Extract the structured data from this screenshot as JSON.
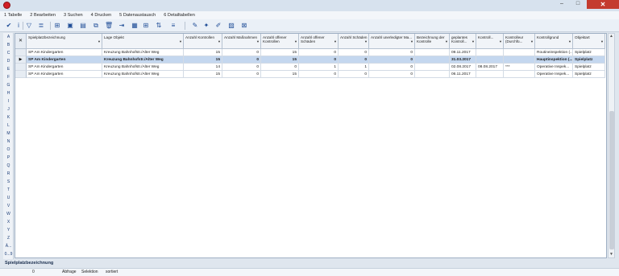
{
  "window": {
    "minimize": "–",
    "maximize": "□",
    "close": "✕"
  },
  "menu": [
    "1 Tabelle",
    "2 Bearbeiten",
    "3 Suchen",
    "4 Drucken",
    "5 Datenaustausch",
    "6 Detailtabellen"
  ],
  "toolbar_icons": [
    {
      "name": "checkmark-icon",
      "glyph": "✔"
    },
    {
      "name": "info-icon",
      "glyph": "i"
    },
    {
      "name": "filter-icon",
      "glyph": "▽"
    },
    {
      "name": "list-options-icon",
      "glyph": "≣"
    },
    {
      "name": "binoculars-icon",
      "glyph": "⊞"
    },
    {
      "name": "search-binoculars-icon",
      "glyph": "▣"
    },
    {
      "name": "document-icon",
      "glyph": "▤"
    },
    {
      "name": "copy-icon",
      "glyph": "⧉"
    },
    {
      "name": "trash-icon",
      "glyph": "🗑"
    },
    {
      "name": "export-icon",
      "glyph": "⇥"
    },
    {
      "name": "table-icon",
      "glyph": "▦"
    },
    {
      "name": "grid-icon",
      "glyph": "⊞"
    },
    {
      "name": "sort-icon",
      "glyph": "⇅"
    },
    {
      "name": "layout-icon",
      "glyph": "≡"
    },
    {
      "name": "edit-icon",
      "glyph": "✎"
    },
    {
      "name": "star-icon",
      "glyph": "✦"
    },
    {
      "name": "brush-icon",
      "glyph": "✐"
    },
    {
      "name": "report-icon",
      "glyph": "▨"
    },
    {
      "name": "clear-icon",
      "glyph": "⊠"
    }
  ],
  "alphabet": [
    "A",
    "B",
    "C",
    "D",
    "E",
    "F",
    "G",
    "H",
    "I",
    "J",
    "K",
    "L",
    "M",
    "N",
    "O",
    "P",
    "Q",
    "R",
    "S",
    "T",
    "U",
    "V",
    "W",
    "X",
    "Y",
    "Z",
    "Ä...",
    "0...9"
  ],
  "columns": [
    {
      "label": "Spielplatzbezeichnung",
      "align": "left"
    },
    {
      "label": "Lage Objekt",
      "align": "left"
    },
    {
      "label": "Anzahl Kontrollen",
      "align": "right"
    },
    {
      "label": "Anzahl Maßnahmen",
      "align": "right"
    },
    {
      "label": "Anzahl offener Kontrollen",
      "align": "right"
    },
    {
      "label": "Anzahl offener Schäden",
      "align": "right"
    },
    {
      "label": "Anzahl Schäden",
      "align": "right"
    },
    {
      "label": "Anzahl unerledigter Ma...",
      "align": "right"
    },
    {
      "label": "Bezeichnung der Kontrolle",
      "align": "left"
    },
    {
      "label": "geplantes Kontroll...",
      "align": "left"
    },
    {
      "label": "Kontroll...",
      "align": "left"
    },
    {
      "label": "Kontrolleur (Durchfü...",
      "align": "left"
    },
    {
      "label": "Kontrollgrund",
      "align": "left"
    },
    {
      "label": "Objektart",
      "align": "left"
    }
  ],
  "rows": [
    [
      "SP Am Kindergarten",
      "Kreuzung Bahnhofstr./Alter Weg",
      "15",
      "0",
      "15",
      "0",
      "0",
      "0",
      "",
      "09.11.2017",
      "",
      "",
      "Routineinspektion (...",
      "Spielplatz"
    ],
    [
      "SP Am Kindergarten",
      "Kreuzung Bahnhofstr./Alter Weg",
      "15",
      "0",
      "15",
      "0",
      "0",
      "0",
      "",
      "31.03.2017",
      "",
      "",
      "Hauptinspektion (...",
      "Spielplatz"
    ],
    [
      "SP Am Kindergarten",
      "Kreuzung Bahnhofstr./Alter Weg",
      "14",
      "0",
      "0",
      "1",
      "1",
      "0",
      "",
      "02.08.2017",
      "08.08.2017",
      "***",
      "Operative Inspek...",
      "Spielplatz"
    ],
    [
      "SP Am Kindergarten",
      "Kreuzung Bahnhofstr./Alter Weg",
      "15",
      "0",
      "15",
      "0",
      "0",
      "0",
      "",
      "06.11.2017",
      "",
      "",
      "Operative Inspek...",
      "Spielplatz"
    ]
  ],
  "selected_row": 1,
  "status_field": "Spielplatzbezeichnung",
  "statusbar": {
    "count": "0",
    "mode": "Abfrage",
    "selection": "Selektion",
    "sorted": "sortiert"
  }
}
